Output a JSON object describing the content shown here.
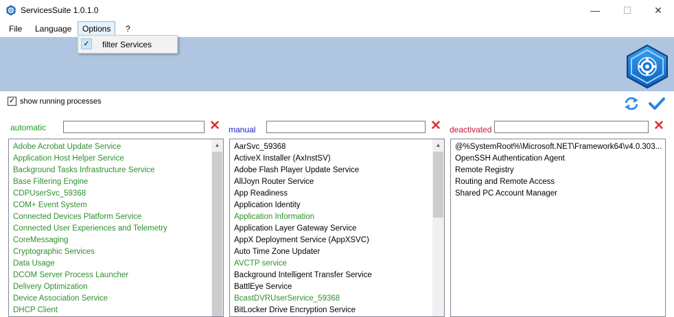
{
  "window": {
    "title": "ServicesSuite 1.0.1.0",
    "minimize_glyph": "—",
    "maximize_glyph": "☐",
    "close_glyph": "✕"
  },
  "menu": {
    "items": [
      "File",
      "Language",
      "Options",
      "?"
    ],
    "options_dropdown": {
      "check_glyph": "✓",
      "label": "filter Services",
      "checked": true
    }
  },
  "toolbar": {
    "show_running_label": "show running processes",
    "show_running_checked": true,
    "check_glyph": "✓",
    "refresh_icon": "refresh-icon",
    "apply_icon": "checkmark-icon"
  },
  "colors": {
    "banner": "#afc5e0",
    "automatic_label": "#1a9e1a",
    "manual_label": "#1a1ac0",
    "deactivated_label": "#c0143c",
    "running_service": "#2f8f2f",
    "clear_icon": "#e03030"
  },
  "columns": {
    "automatic": {
      "label": "automatic",
      "filter_value": "",
      "clear_glyph": "✕",
      "items": [
        {
          "text": "Adobe Acrobat Update Service",
          "running": true
        },
        {
          "text": "Application Host Helper Service",
          "running": true
        },
        {
          "text": "Background Tasks Infrastructure Service",
          "running": true
        },
        {
          "text": "Base Filtering Engine",
          "running": true
        },
        {
          "text": "CDPUserSvc_59368",
          "running": true
        },
        {
          "text": "COM+ Event System",
          "running": true
        },
        {
          "text": "Connected Devices Platform Service",
          "running": true
        },
        {
          "text": "Connected User Experiences and Telemetry",
          "running": true
        },
        {
          "text": "CoreMessaging",
          "running": true
        },
        {
          "text": "Cryptographic Services",
          "running": true
        },
        {
          "text": "Data Usage",
          "running": true
        },
        {
          "text": "DCOM Server Process Launcher",
          "running": true
        },
        {
          "text": "Delivery Optimization",
          "running": true
        },
        {
          "text": "Device Association Service",
          "running": true
        },
        {
          "text": "DHCP Client",
          "running": true
        }
      ]
    },
    "manual": {
      "label": "manual",
      "filter_value": "",
      "clear_glyph": "✕",
      "items": [
        {
          "text": "AarSvc_59368",
          "running": false
        },
        {
          "text": "ActiveX Installer (AxInstSV)",
          "running": false
        },
        {
          "text": "Adobe Flash Player Update Service",
          "running": false
        },
        {
          "text": "AllJoyn Router Service",
          "running": false
        },
        {
          "text": "App Readiness",
          "running": false
        },
        {
          "text": "Application Identity",
          "running": false
        },
        {
          "text": "Application Information",
          "running": true
        },
        {
          "text": "Application Layer Gateway Service",
          "running": false
        },
        {
          "text": "AppX Deployment Service (AppXSVC)",
          "running": false
        },
        {
          "text": "Auto Time Zone Updater",
          "running": false
        },
        {
          "text": "AVCTP service",
          "running": true
        },
        {
          "text": "Background Intelligent Transfer Service",
          "running": false
        },
        {
          "text": "BattlEye Service",
          "running": false
        },
        {
          "text": "BcastDVRUserService_59368",
          "running": true
        },
        {
          "text": "BitLocker Drive Encryption Service",
          "running": false
        }
      ]
    },
    "deactivated": {
      "label": "deactivated",
      "filter_value": "",
      "clear_glyph": "✕",
      "items": [
        {
          "text": "@%SystemRoot%\\Microsoft.NET\\Framework64\\v4.0.303...",
          "running": false
        },
        {
          "text": "OpenSSH Authentication Agent",
          "running": false
        },
        {
          "text": "Remote Registry",
          "running": false
        },
        {
          "text": "Routing and Remote Access",
          "running": false
        },
        {
          "text": "Shared PC Account Manager",
          "running": false
        }
      ]
    }
  }
}
